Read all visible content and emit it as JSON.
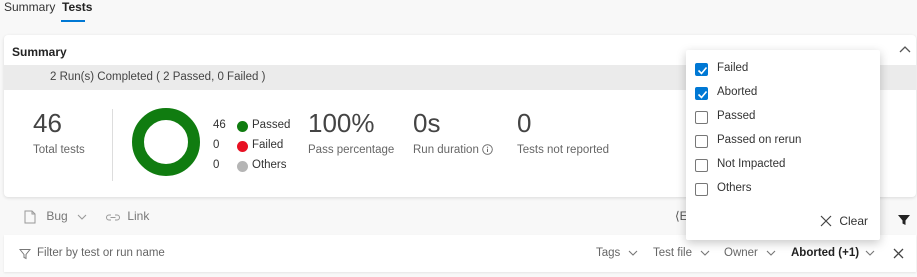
{
  "tabs": [
    {
      "label": "Summary"
    },
    {
      "label": "Tests"
    }
  ],
  "summary": {
    "title": "Summary",
    "run_status": "2 Run(s) Completed ( 2 Passed, 0 Failed )",
    "total_tests": {
      "value": "46",
      "label": "Total tests"
    },
    "legend": [
      {
        "count": "46",
        "label": "Passed",
        "color": "#107c10"
      },
      {
        "count": "0",
        "label": "Failed",
        "color": "#e81123"
      },
      {
        "count": "0",
        "label": "Others",
        "color": "#b5b5b5"
      }
    ],
    "pass_percentage": {
      "value": "100%",
      "label": "Pass percentage"
    },
    "run_duration": {
      "value": "0s",
      "label": "Run duration"
    },
    "not_reported": {
      "value": "0",
      "label": "Tests not reported"
    },
    "donut": {
      "passed": 46,
      "failed": 0,
      "others": 0
    }
  },
  "toolbar": {
    "bug_label": "Bug",
    "link_label": "Link",
    "truncated_label": "⟨E"
  },
  "filter_bar": {
    "placeholder": "Filter by test or run name",
    "tags_label": "Tags",
    "test_file_label": "Test file",
    "owner_label": "Owner",
    "outcome_label": "Aborted (+1)"
  },
  "outcome_dropdown": {
    "options": [
      {
        "label": "Failed",
        "checked": true
      },
      {
        "label": "Aborted",
        "checked": true
      },
      {
        "label": "Passed",
        "checked": false
      },
      {
        "label": "Passed on rerun",
        "checked": false
      },
      {
        "label": "Not Impacted",
        "checked": false
      },
      {
        "label": "Others",
        "checked": false
      }
    ],
    "clear_label": "Clear"
  },
  "colors": {
    "accent": "#0078d4",
    "passed": "#107c10",
    "failed": "#e81123",
    "others": "#b5b5b5"
  }
}
